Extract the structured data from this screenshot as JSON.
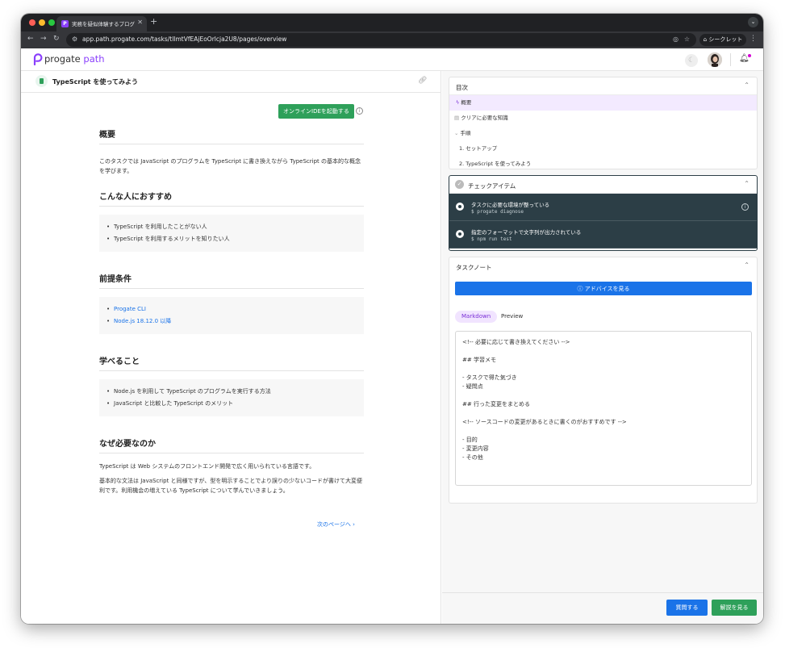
{
  "browser": {
    "tab_title": "実務を疑似体験するプログラミ...",
    "tab_favicon": "P",
    "url": "app.path.progate.com/tasks/tIlmtVfEAjEoOrlcja2U8/pages/overview",
    "incognito_label": "シークレット"
  },
  "app": {
    "logo_word1": "progate",
    "logo_word2": "path",
    "brand_color": "#8a3ffc"
  },
  "task": {
    "title": "TypeScript を使ってみよう",
    "ide_button": "オンラインIDEを起動する",
    "info": "i"
  },
  "doc": {
    "overview_h": "概要",
    "overview_p": "このタスクでは JavaScript のプログラムを TypeScript に書き換えながら TypeScript の基本的な概念を学びます。",
    "recommend_h": "こんな人におすすめ",
    "recommend": [
      "TypeScript を利用したことがない人",
      "TypeScript を利用するメリットを知りたい人"
    ],
    "prereq_h": "前提条件",
    "prereq": [
      "Progate CLI",
      "Node.js 18.12.0 以降"
    ],
    "learn_h": "学べること",
    "learn": [
      "Node.js を利用して TypeScript のプログラムを実行する方法",
      "JavaScript と比較した TypeScript のメリット"
    ],
    "why_h": "なぜ必要なのか",
    "why_p1": "TypeScript は Web システムのフロントエンド開発で広く用いられている言語です。",
    "why_p2": "基本的な文法は JavaScript と同様ですが、型を明示することでより誤りの少ないコードが書けて大変便利です。利用機会の増えている TypeScript について学んでいきましょう。",
    "next": "次のページへ"
  },
  "toc": {
    "title": "目次",
    "items": [
      "概要",
      "クリアに必要な知識",
      "手順",
      "1. セットアップ",
      "2. TypeScript を使ってみよう"
    ]
  },
  "checks": {
    "title": "チェックアイテム",
    "items": [
      {
        "label": "タスクに必要な環境が整っている",
        "cmd": "$ progate diagnose"
      },
      {
        "label": "指定のフォーマットで文字列が出力されている",
        "cmd": "$ npm run test"
      }
    ]
  },
  "notes": {
    "title": "タスクノート",
    "advice_button": "アドバイスを見る",
    "tab_markdown": "Markdown",
    "tab_preview": "Preview",
    "lines": [
      "<!-- 必要に応じて書き換えてください -->",
      "",
      "## 学習メモ",
      "",
      "- タスクで得た気づき",
      "- 疑問点",
      "",
      "## 行った変更をまとめる",
      "",
      "<!-- ソースコードの変更があるときに書くのがおすすめです -->",
      "",
      "- 目的",
      "- 変更内容",
      "- その他"
    ]
  },
  "footer": {
    "question_button": "質問する",
    "answer_button": "解説を見る"
  }
}
